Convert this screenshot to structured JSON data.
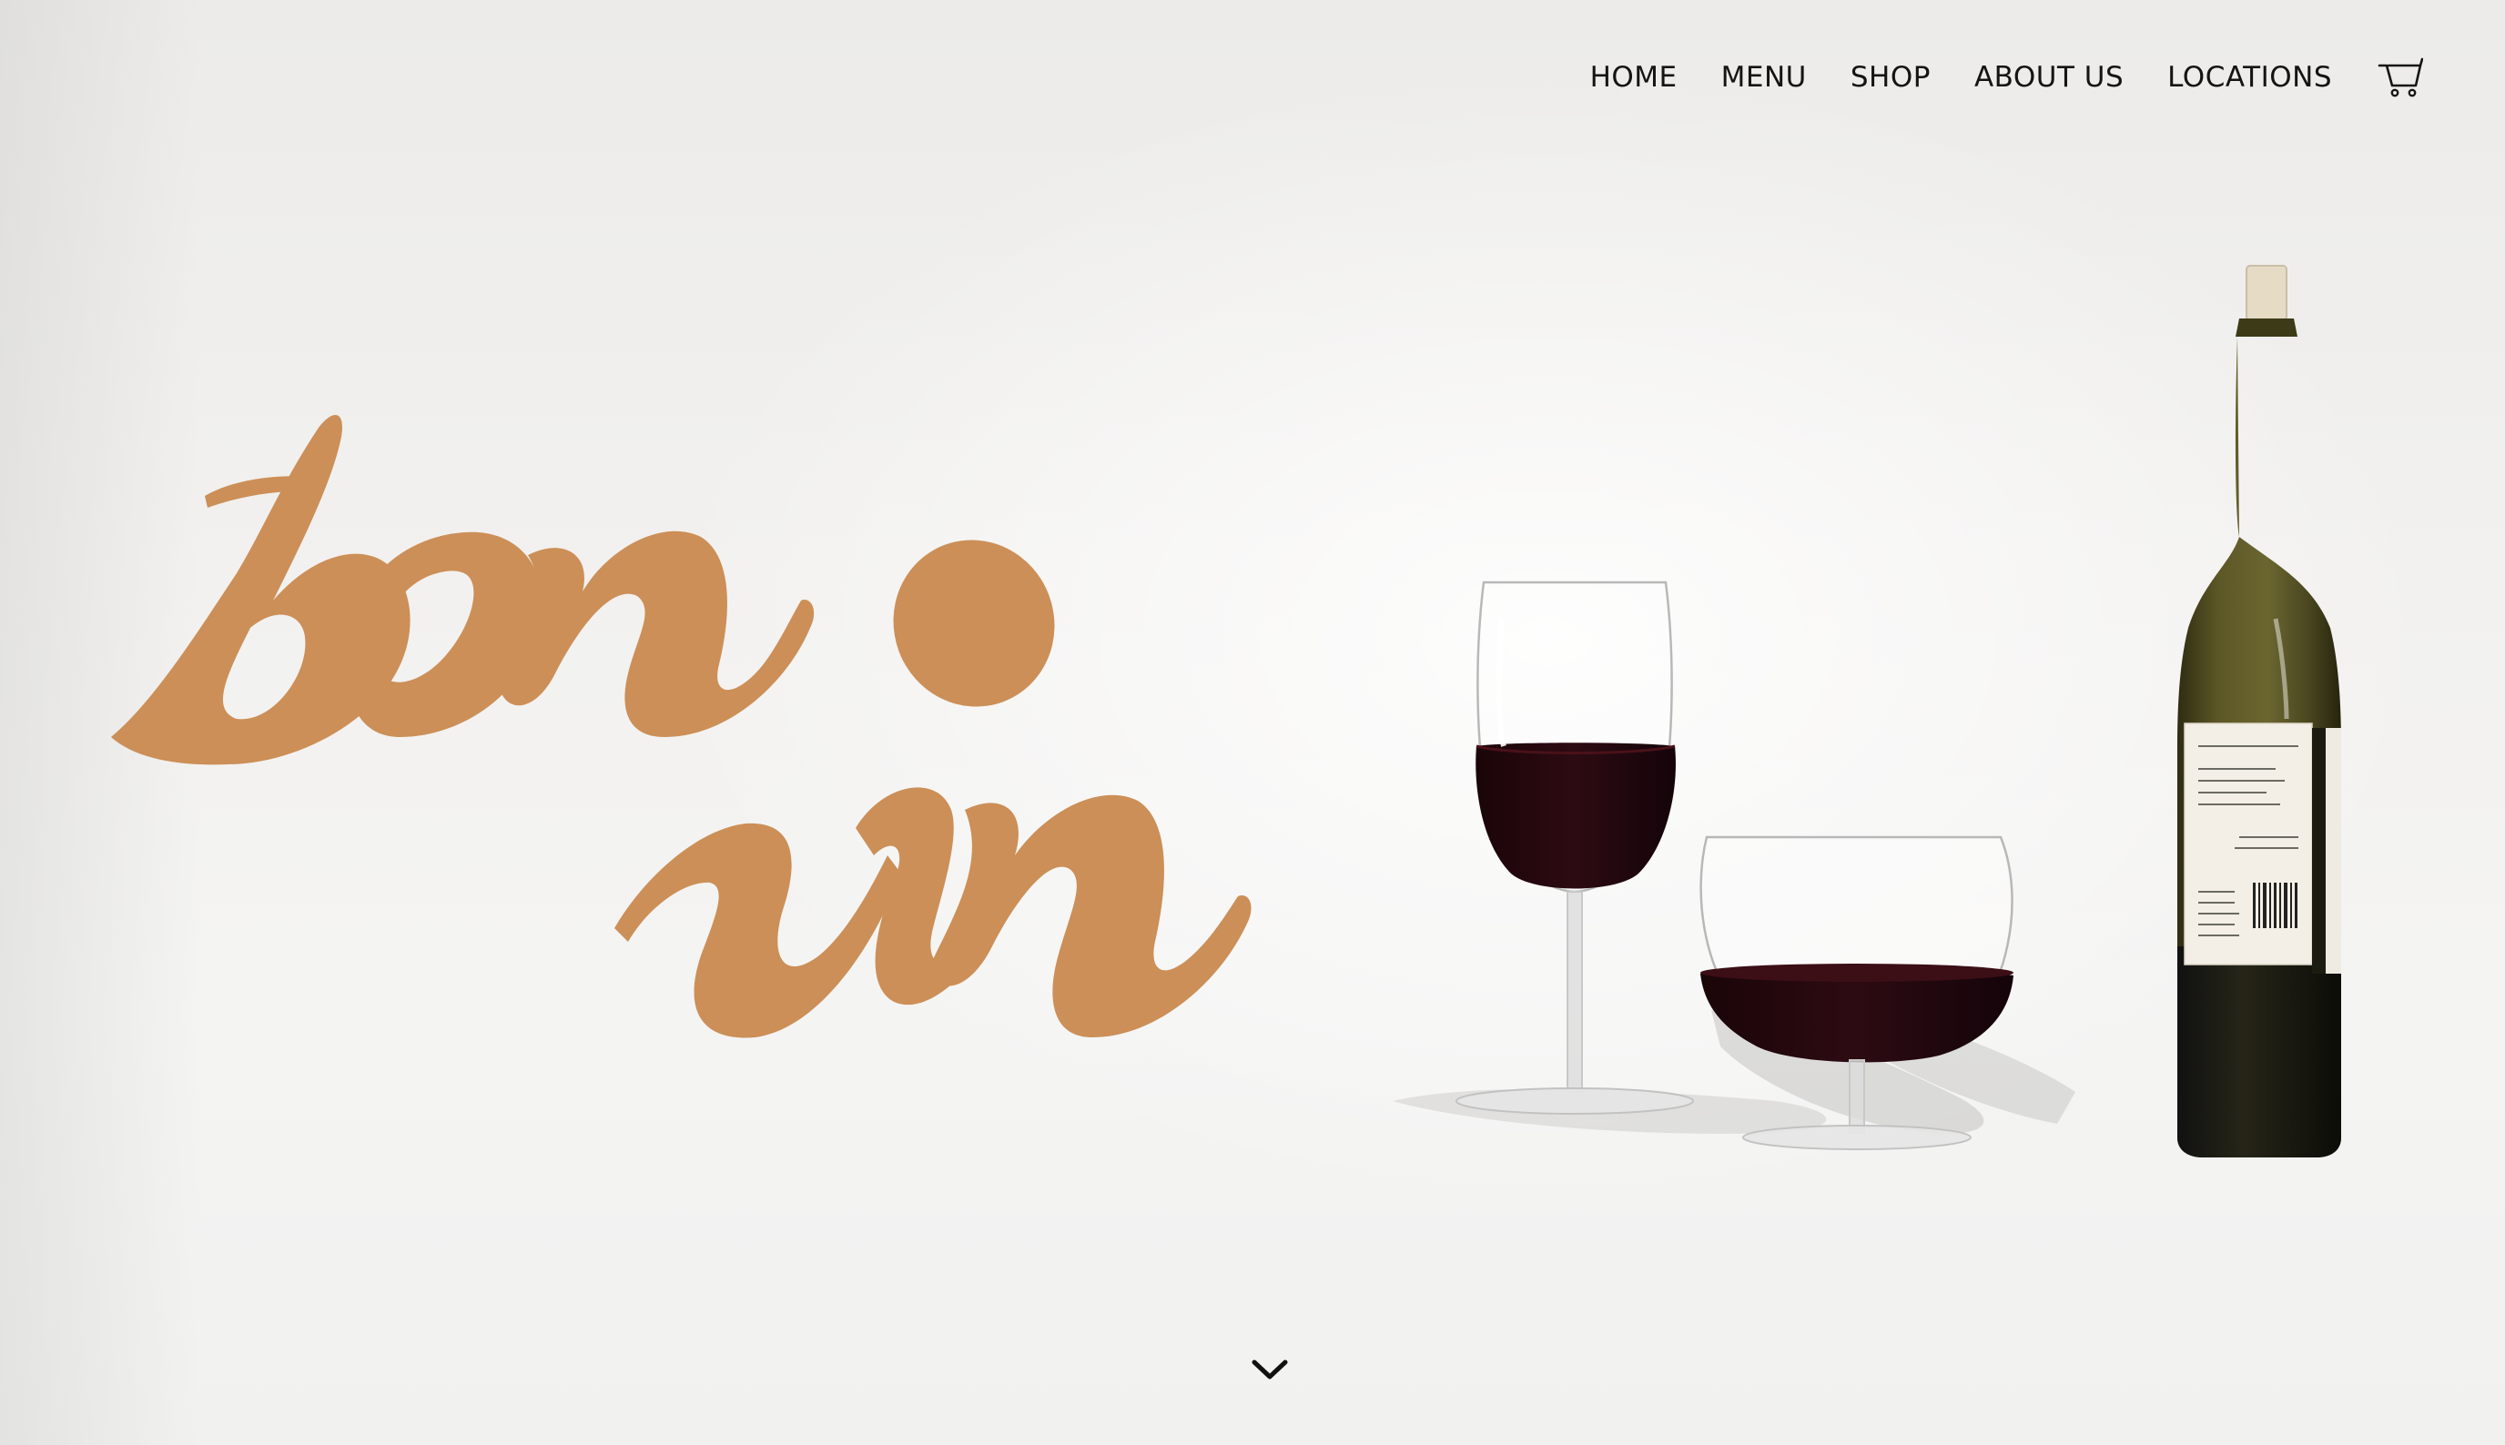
{
  "nav": {
    "items": [
      {
        "label": "HOME"
      },
      {
        "label": "MENU"
      },
      {
        "label": "SHOP"
      },
      {
        "label": "ABOUT US"
      },
      {
        "label": "LOCATIONS"
      }
    ],
    "cart_icon": "shopping-cart-icon"
  },
  "logo": {
    "text": "bon vin",
    "color": "#cc8f57"
  },
  "hero": {
    "image": "wine-bottle-and-two-glasses",
    "scroll_icon": "chevron-down-icon"
  },
  "colors": {
    "brand": "#cc8f57",
    "wine": "#2a0a10",
    "bottle": "#4a4722",
    "text": "#141414"
  }
}
